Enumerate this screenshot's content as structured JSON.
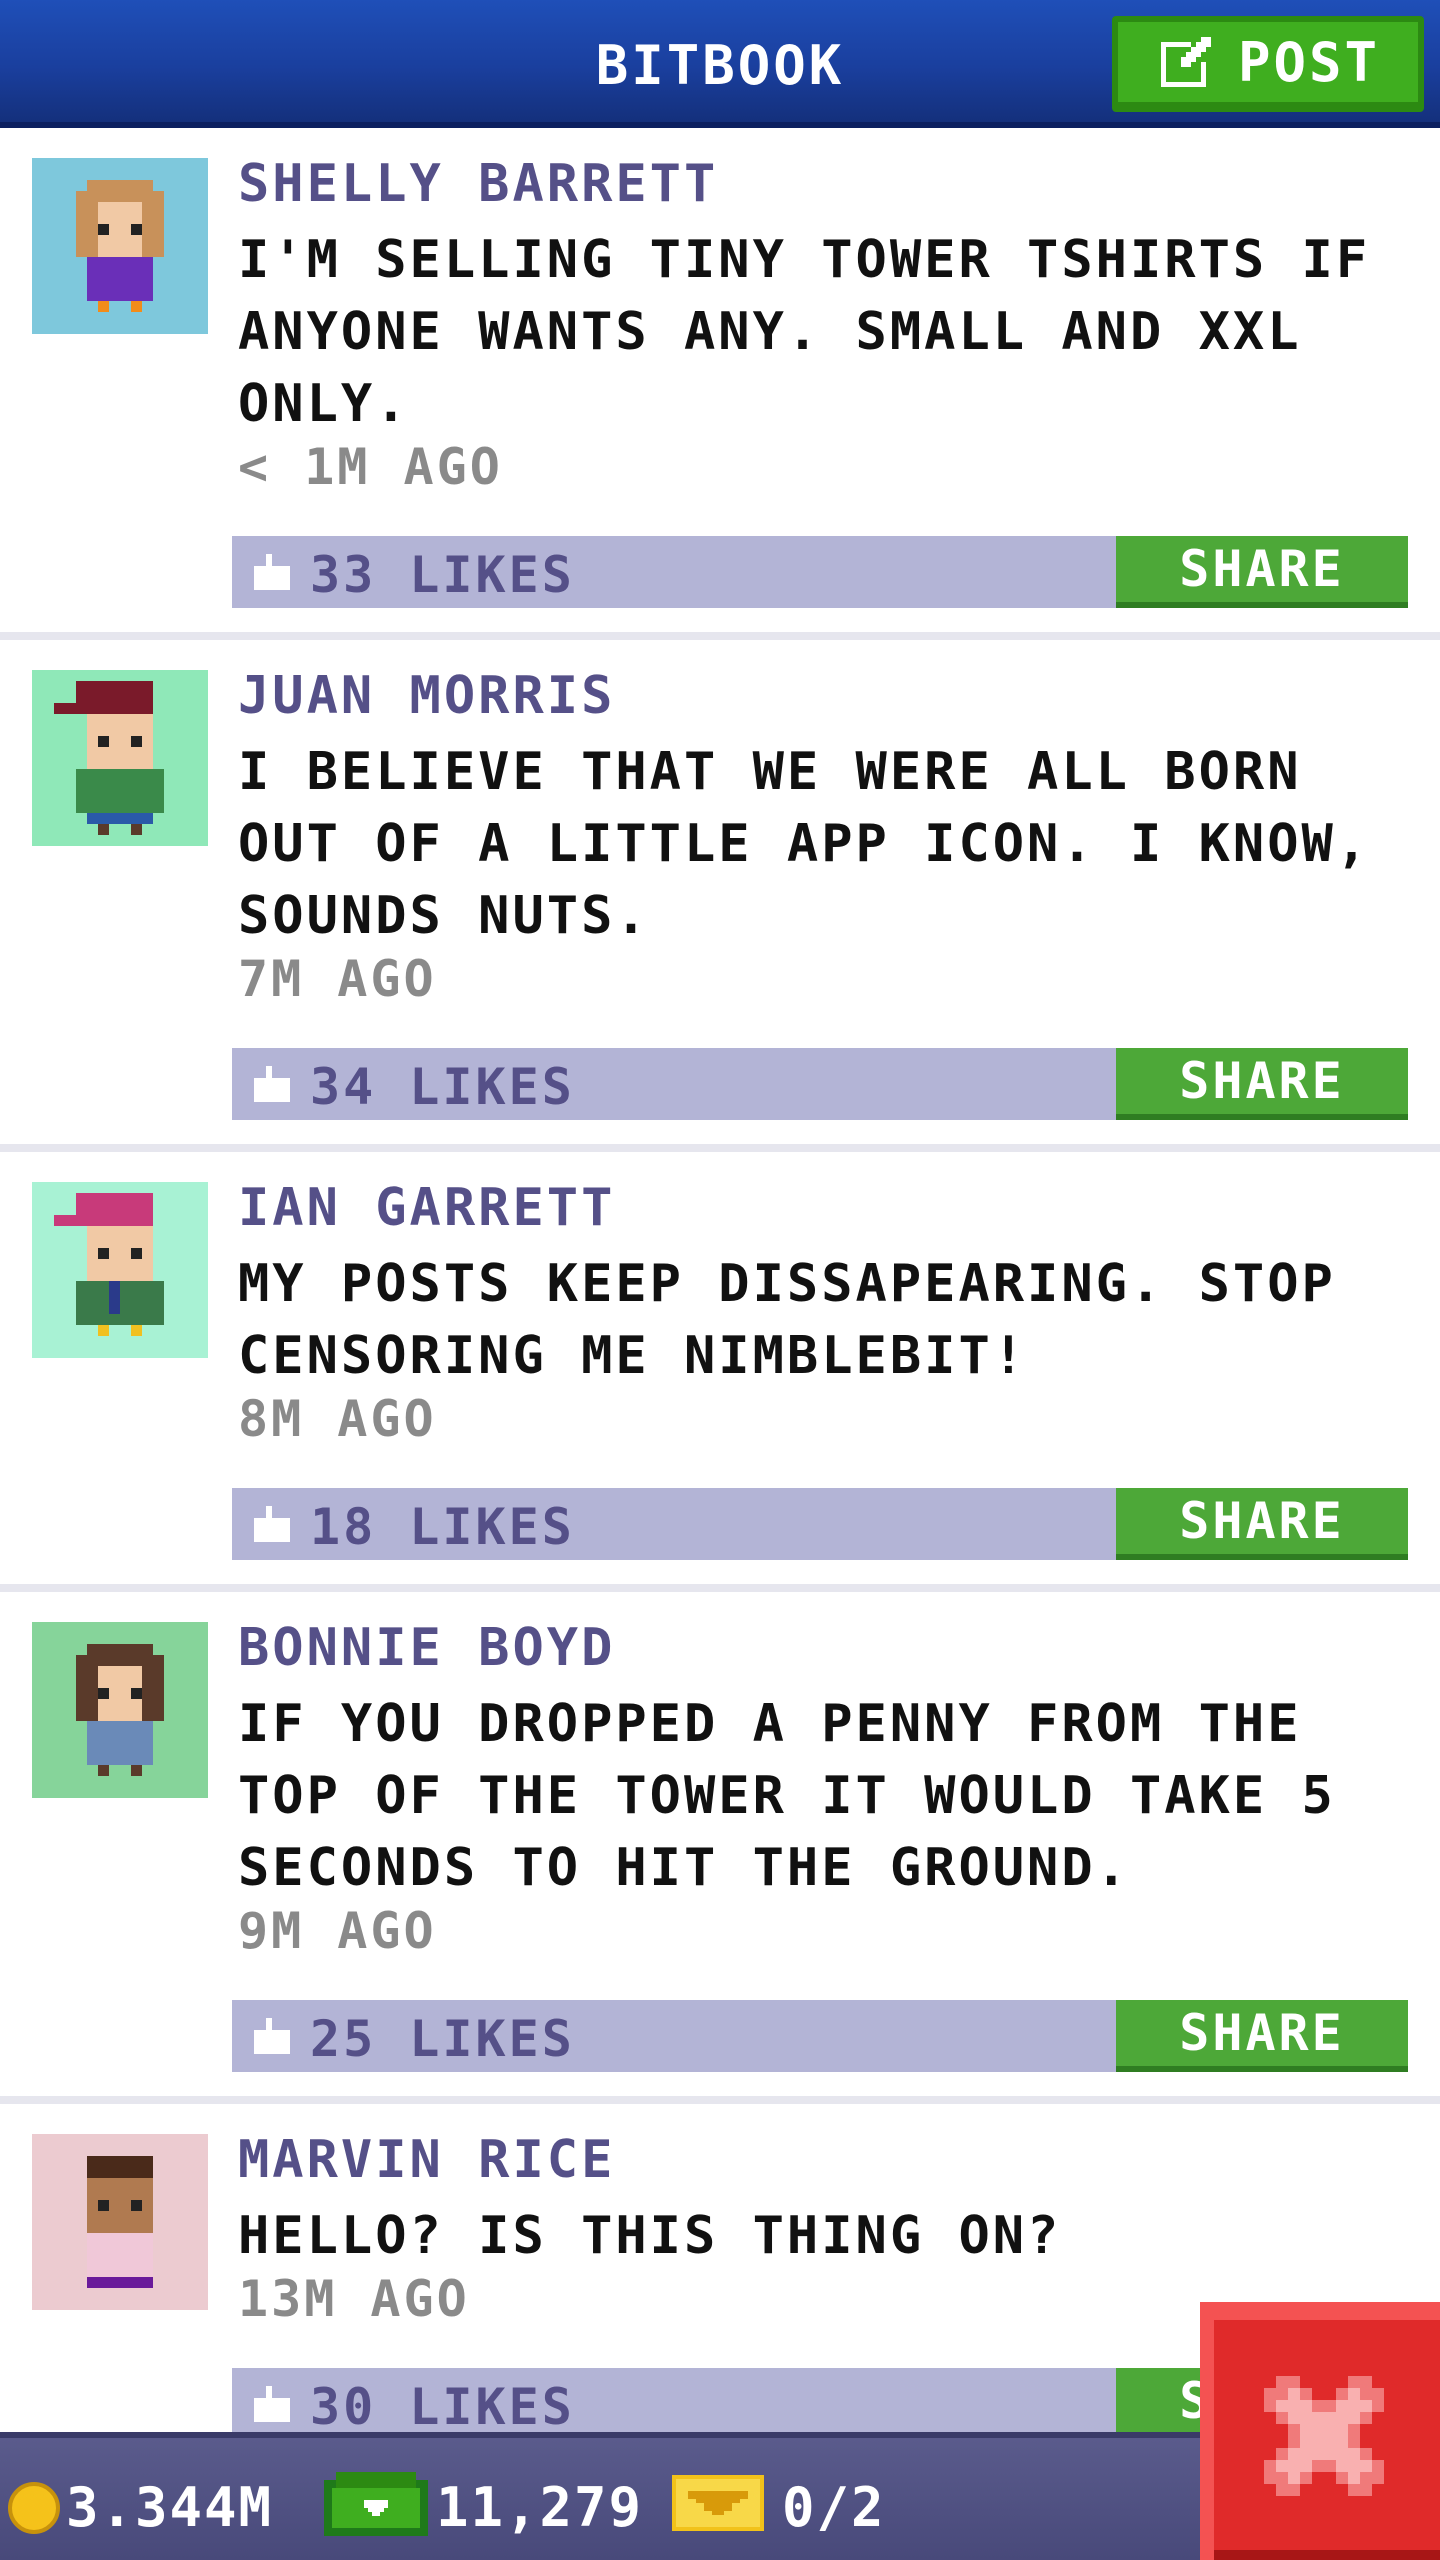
{
  "header": {
    "title": "BITBOOK",
    "post_label": "POST"
  },
  "posts": [
    {
      "name": "SHELLY BARRETT",
      "message": "I'M SELLING TINY TOWER TSHIRTS IF ANYONE WANTS ANY. SMALL AND XXL ONLY.",
      "time": "< 1M AGO",
      "likes": "33 LIKES",
      "share": "SHARE",
      "avatar_bg": "#7ec8dc"
    },
    {
      "name": "JUAN MORRIS",
      "message": "I BELIEVE THAT WE WERE ALL BORN OUT OF A LITTLE APP ICON. I KNOW, SOUNDS NUTS.",
      "time": "7M AGO",
      "likes": "34 LIKES",
      "share": "SHARE",
      "avatar_bg": "#8fe8b8"
    },
    {
      "name": "IAN GARRETT",
      "message": "MY POSTS KEEP DISSAPEARING. STOP CENSORING ME NIMBLEBIT!",
      "time": "8M AGO",
      "likes": "18 LIKES",
      "share": "SHARE",
      "avatar_bg": "#a8f2d4"
    },
    {
      "name": "BONNIE BOYD",
      "message": "IF YOU DROPPED A PENNY FROM THE TOP OF THE TOWER IT WOULD TAKE 5 SECONDS TO HIT THE GROUND.",
      "time": "9M AGO",
      "likes": "25 LIKES",
      "share": "SHARE",
      "avatar_bg": "#86d49a"
    },
    {
      "name": "MARVIN RICE",
      "message": "HELLO? IS THIS THING ON?",
      "time": "13M AGO",
      "likes": "30 LIKES",
      "share": "SHARE",
      "avatar_bg": "#eccbd0"
    }
  ],
  "status_bar": {
    "coins": "3.344M",
    "bux": "11,279",
    "tickets": "0/2"
  },
  "colors": {
    "header_blue": "#1a3f9e",
    "post_green": "#3fae1f",
    "likes_bar": "#b3b4d6",
    "share_green": "#4da838",
    "close_red": "#e02a2a"
  }
}
